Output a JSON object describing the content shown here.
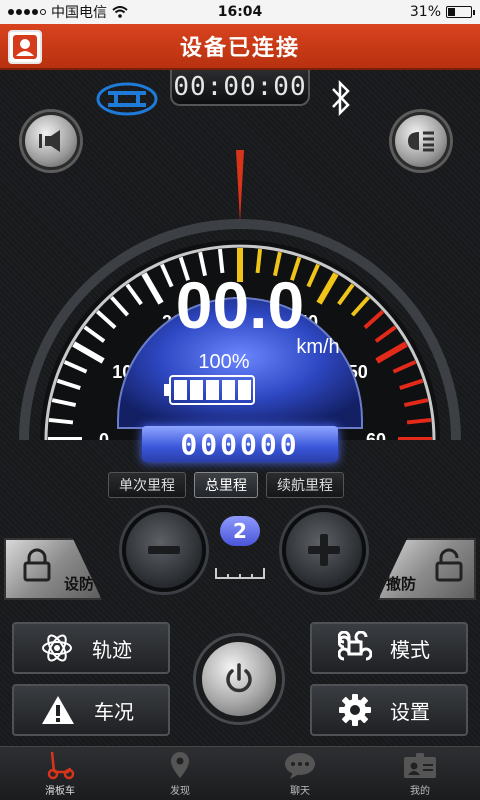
{
  "status_bar": {
    "carrier": "中国电信",
    "time": "16:04",
    "battery": "31%",
    "battery_level": 0.31
  },
  "title": "设备已连接",
  "timer": "00:00:00",
  "speed": {
    "value": "00.0",
    "unit": "km/h",
    "battery_percent": "100%",
    "battery_cells": 5,
    "ticks": [
      "0",
      "10",
      "20",
      "30",
      "40",
      "50",
      "60"
    ]
  },
  "odometer": "000000",
  "tabs": [
    {
      "label": "单次里程",
      "active": false
    },
    {
      "label": "总里程",
      "active": true
    },
    {
      "label": "续航里程",
      "active": false
    }
  ],
  "gear": "2",
  "lock": {
    "arm_label": "设防",
    "disarm_label": "撤防"
  },
  "functions": {
    "track": "轨迹",
    "mode": "模式",
    "status": "车况",
    "settings": "设置"
  },
  "nav": [
    {
      "label": "滑板车",
      "icon": "scooter-icon",
      "active": true
    },
    {
      "label": "发现",
      "icon": "location-pin-icon",
      "active": false
    },
    {
      "label": "聊天",
      "icon": "chat-icon",
      "active": false
    },
    {
      "label": "我的",
      "icon": "profile-card-icon",
      "active": false
    }
  ],
  "colors": {
    "accent_red": "#c8371a",
    "blue": "#3b56d8"
  }
}
